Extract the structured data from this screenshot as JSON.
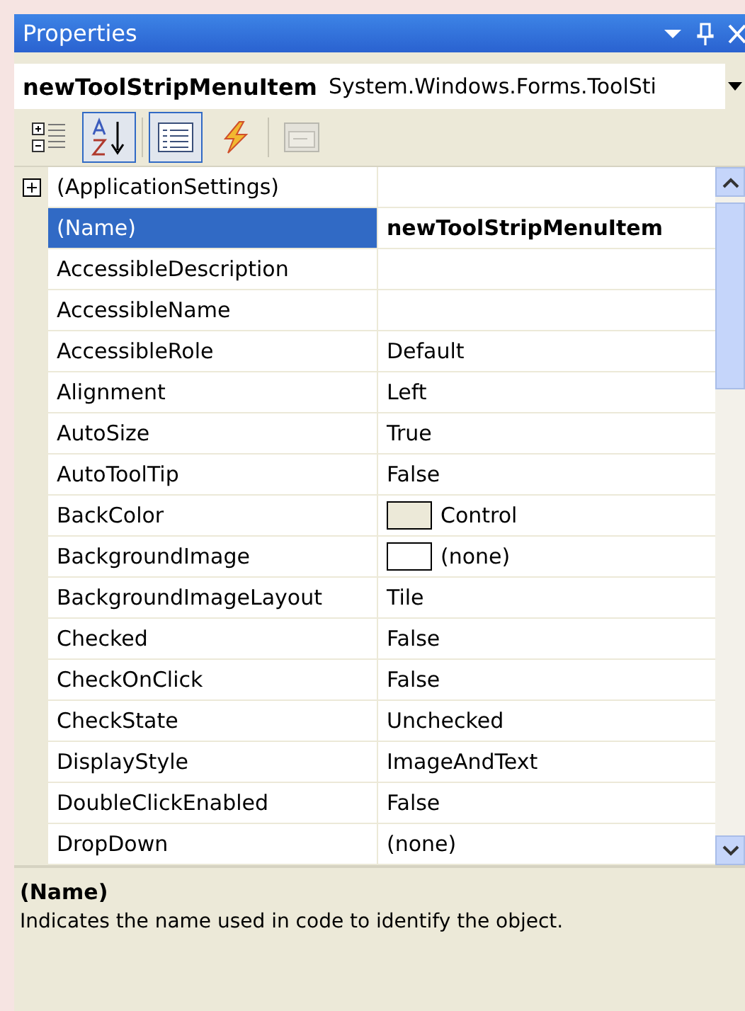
{
  "window": {
    "title": "Properties"
  },
  "object_selector": {
    "name": "newToolStripMenuItem",
    "type": "System.Windows.Forms.ToolSti"
  },
  "toolbar": [
    {
      "kind": "categorized",
      "selected": false,
      "disabled": false
    },
    {
      "kind": "alphabetical",
      "selected": true,
      "disabled": false
    },
    {
      "kind": "properties",
      "selected": true,
      "disabled": false
    },
    {
      "kind": "events",
      "selected": false,
      "disabled": false
    },
    {
      "kind": "pages",
      "selected": false,
      "disabled": true
    }
  ],
  "grid": {
    "rows": [
      {
        "name": "(ApplicationSettings)",
        "kind": "group",
        "expanded": false,
        "selected": false
      },
      {
        "name": "(Name)",
        "value": "newToolStripMenuItem",
        "kind": "text",
        "selected": true,
        "modified": true
      },
      {
        "name": "AccessibleDescription",
        "kind": "text",
        "selected": false
      },
      {
        "name": "AccessibleName",
        "kind": "text",
        "selected": false
      },
      {
        "name": "AccessibleRole",
        "value": "Default",
        "kind": "text",
        "selected": false,
        "modified": false
      },
      {
        "name": "Alignment",
        "value": "Left",
        "kind": "text",
        "selected": false,
        "modified": false
      },
      {
        "name": "AutoSize",
        "value": "True",
        "kind": "text",
        "selected": false,
        "modified": false
      },
      {
        "name": "AutoToolTip",
        "value": "False",
        "kind": "text",
        "selected": false,
        "modified": false
      },
      {
        "name": "BackColor",
        "value": "Control",
        "kind": "swatch",
        "color": "#ece9d8",
        "selected": false,
        "modified": false
      },
      {
        "name": "BackgroundImage",
        "value": "(none)",
        "kind": "swatch",
        "color": "#ffffff",
        "selected": false,
        "modified": false
      },
      {
        "name": "BackgroundImageLayout",
        "value": "Tile",
        "kind": "text",
        "selected": false,
        "modified": false
      },
      {
        "name": "Checked",
        "value": "False",
        "kind": "text",
        "selected": false,
        "modified": false
      },
      {
        "name": "CheckOnClick",
        "value": "False",
        "kind": "text",
        "selected": false,
        "modified": false
      },
      {
        "name": "CheckState",
        "value": "Unchecked",
        "kind": "text",
        "selected": false,
        "modified": false
      },
      {
        "name": "DisplayStyle",
        "value": "ImageAndText",
        "kind": "text",
        "selected": false,
        "modified": false
      },
      {
        "name": "DoubleClickEnabled",
        "value": "False",
        "kind": "text",
        "selected": false,
        "modified": false
      },
      {
        "name": "DropDown",
        "value": "(none)",
        "kind": "text",
        "selected": false,
        "modified": false
      }
    ]
  },
  "description": {
    "title": "(Name)",
    "text": "Indicates the name used in code to identify the object."
  }
}
